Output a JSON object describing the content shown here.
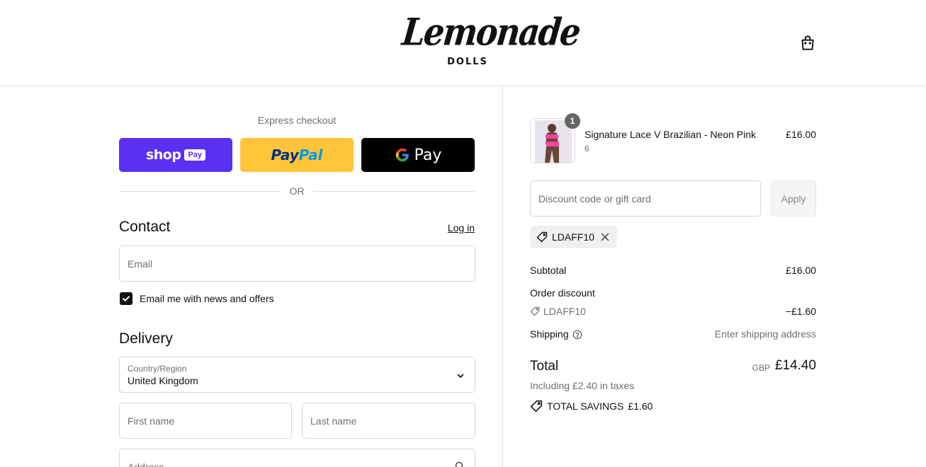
{
  "header": {
    "brand_script": "Lemonade",
    "brand_sub": "DOLLS"
  },
  "express": {
    "title": "Express checkout",
    "shop_label": "shop",
    "shop_pay": "Pay",
    "paypal_1": "Pay",
    "paypal_2": "Pal",
    "gpay_label": "Pay",
    "or_label": "OR"
  },
  "contact": {
    "title": "Contact",
    "login_label": "Log in",
    "email_placeholder": "Email",
    "newsletter_label": "Email me with news and offers",
    "newsletter_checked": true
  },
  "delivery": {
    "title": "Delivery",
    "country_label": "Country/Region",
    "country_value": "United Kingdom",
    "first_name_placeholder": "First name",
    "last_name_placeholder": "Last name",
    "address_placeholder": "Address"
  },
  "order": {
    "item": {
      "quantity": "1",
      "name": "Signature Lace V Brazilian - Neon Pink",
      "variant": "6",
      "price": "£16.00"
    },
    "discount_placeholder": "Discount code or gift card",
    "apply_label": "Apply",
    "applied_code": "LDAFF10",
    "subtotal_label": "Subtotal",
    "subtotal_value": "£16.00",
    "order_discount_label": "Order discount",
    "discount_code": "LDAFF10",
    "discount_value": "−£1.60",
    "shipping_label": "Shipping",
    "shipping_value": "Enter shipping address",
    "total_label": "Total",
    "currency": "GBP",
    "total_value": "£14.40",
    "taxes_note": "Including £2.40 in taxes",
    "savings_label": "TOTAL SAVINGS",
    "savings_value": "£1.60"
  },
  "colors": {
    "shop_pay": "#5a31f4",
    "paypal": "#ffc439",
    "gpay": "#000000",
    "border": "#dedede"
  }
}
